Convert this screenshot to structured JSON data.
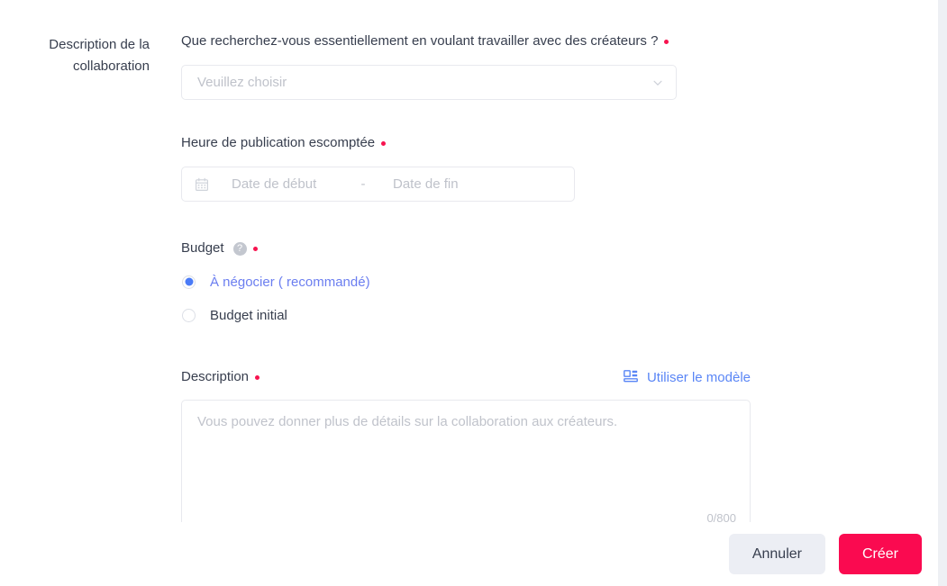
{
  "section": {
    "label_line1": "Description de la",
    "label_line2": "collaboration"
  },
  "fields": {
    "goal": {
      "label": "Que recherchez-vous essentiellement en voulant travailler avec des créateurs ?",
      "required": true,
      "placeholder": "Veuillez choisir",
      "value": "",
      "icon": "chevron-down-icon"
    },
    "publish_time": {
      "label": "Heure de publication escomptée",
      "required": true,
      "icon": "calendar-icon",
      "start_placeholder": "Date de début",
      "separator": "-",
      "end_placeholder": "Date de fin",
      "start_value": "",
      "end_value": ""
    },
    "budget": {
      "label": "Budget",
      "required": true,
      "help_icon": "question-circle-icon",
      "help_glyph": "?",
      "options": [
        {
          "label": "À négocier ( recommandé)",
          "selected": true
        },
        {
          "label": "Budget initial",
          "selected": false
        }
      ]
    },
    "description": {
      "label": "Description",
      "required": true,
      "template_link": "Utiliser le modèle",
      "template_icon": "template-layout-icon",
      "placeholder": "Vous pouvez donner plus de détails sur la collaboration aux créateurs.",
      "value": "",
      "counter": "0/800"
    }
  },
  "footer": {
    "cancel_label": "Annuler",
    "submit_label": "Créer"
  },
  "colors": {
    "accent_pink": "#fa0a50",
    "required_dot": "#f7134f",
    "link_blue": "#5a86f6",
    "radio_blue": "#4a7bf7",
    "radio_label_accent": "#6b7ef0",
    "text_primary": "#373e4e",
    "placeholder": "#bfc2ca",
    "border": "#e8e9ee",
    "cancel_bg": "#eceef4",
    "page_bg": "#eef0f4"
  }
}
